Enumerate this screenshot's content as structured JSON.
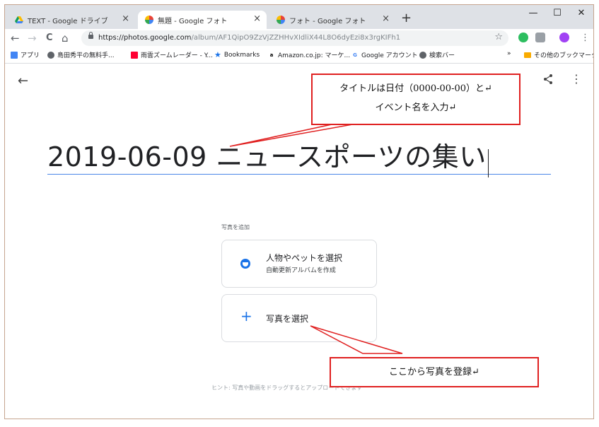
{
  "tabs": [
    {
      "title": "TEXT - Google ドライブ",
      "active": false
    },
    {
      "title": "無題 - Google フォト",
      "active": true
    },
    {
      "title": "フォト - Google フォト",
      "active": false
    }
  ],
  "window_controls": {
    "minimize": "—",
    "maximize": "☐",
    "close": "✕"
  },
  "toolbar": {
    "back_icon": "←",
    "forward_icon": "→",
    "reload_icon": "C",
    "home_icon": "⌂",
    "url_host": "https://photos.google.com",
    "url_path": "/album/AF1QipO9ZzVjZZHHvXIdliX44L8O6dyEzi8x3rgKIFh1",
    "bookmark_star": "☆",
    "menu_icon": "⋮"
  },
  "bookmarks": [
    {
      "label": "アプリ",
      "icon": "apps-icon"
    },
    {
      "label": "島田秀平の無料手...",
      "icon": "globe-icon"
    },
    {
      "label": "雨雲ズームレーダー - Y...",
      "icon": "yahoo-icon"
    },
    {
      "label": "Bookmarks",
      "icon": "star-icon"
    },
    {
      "label": "Amazon.co.jp: マーケ...",
      "icon": "amazon-icon"
    },
    {
      "label": "Google アカウント",
      "icon": "google-icon"
    },
    {
      "label": "検索バー",
      "icon": "globe-icon"
    },
    {
      "label": "»",
      "icon": ""
    },
    {
      "label": "その他のブックマーク",
      "icon": "folder-icon"
    }
  ],
  "page": {
    "back_icon": "←",
    "share_icon": "share-icon",
    "more_icon": "⋮",
    "album_title": "2019-06-09 ニュースポーツの集い",
    "add_photos_label": "写真を追加",
    "option_people": {
      "title": "人物やペットを選択",
      "subtitle": "自動更新アルバムを作成"
    },
    "option_select": {
      "plus": "+",
      "title": "写真を選択"
    },
    "hint": "ヒント: 写真や動画をドラッグするとアップロードできます"
  },
  "callouts": {
    "title_note_line1": "タイトルは日付（0000-00-00）と↵",
    "title_note_line2": "イベント名を入力↵",
    "photo_note": "ここから写真を登録↵"
  },
  "colors": {
    "accent": "#1a73e8",
    "callout_border": "#e02020",
    "tabbar": "#dee1e6"
  }
}
